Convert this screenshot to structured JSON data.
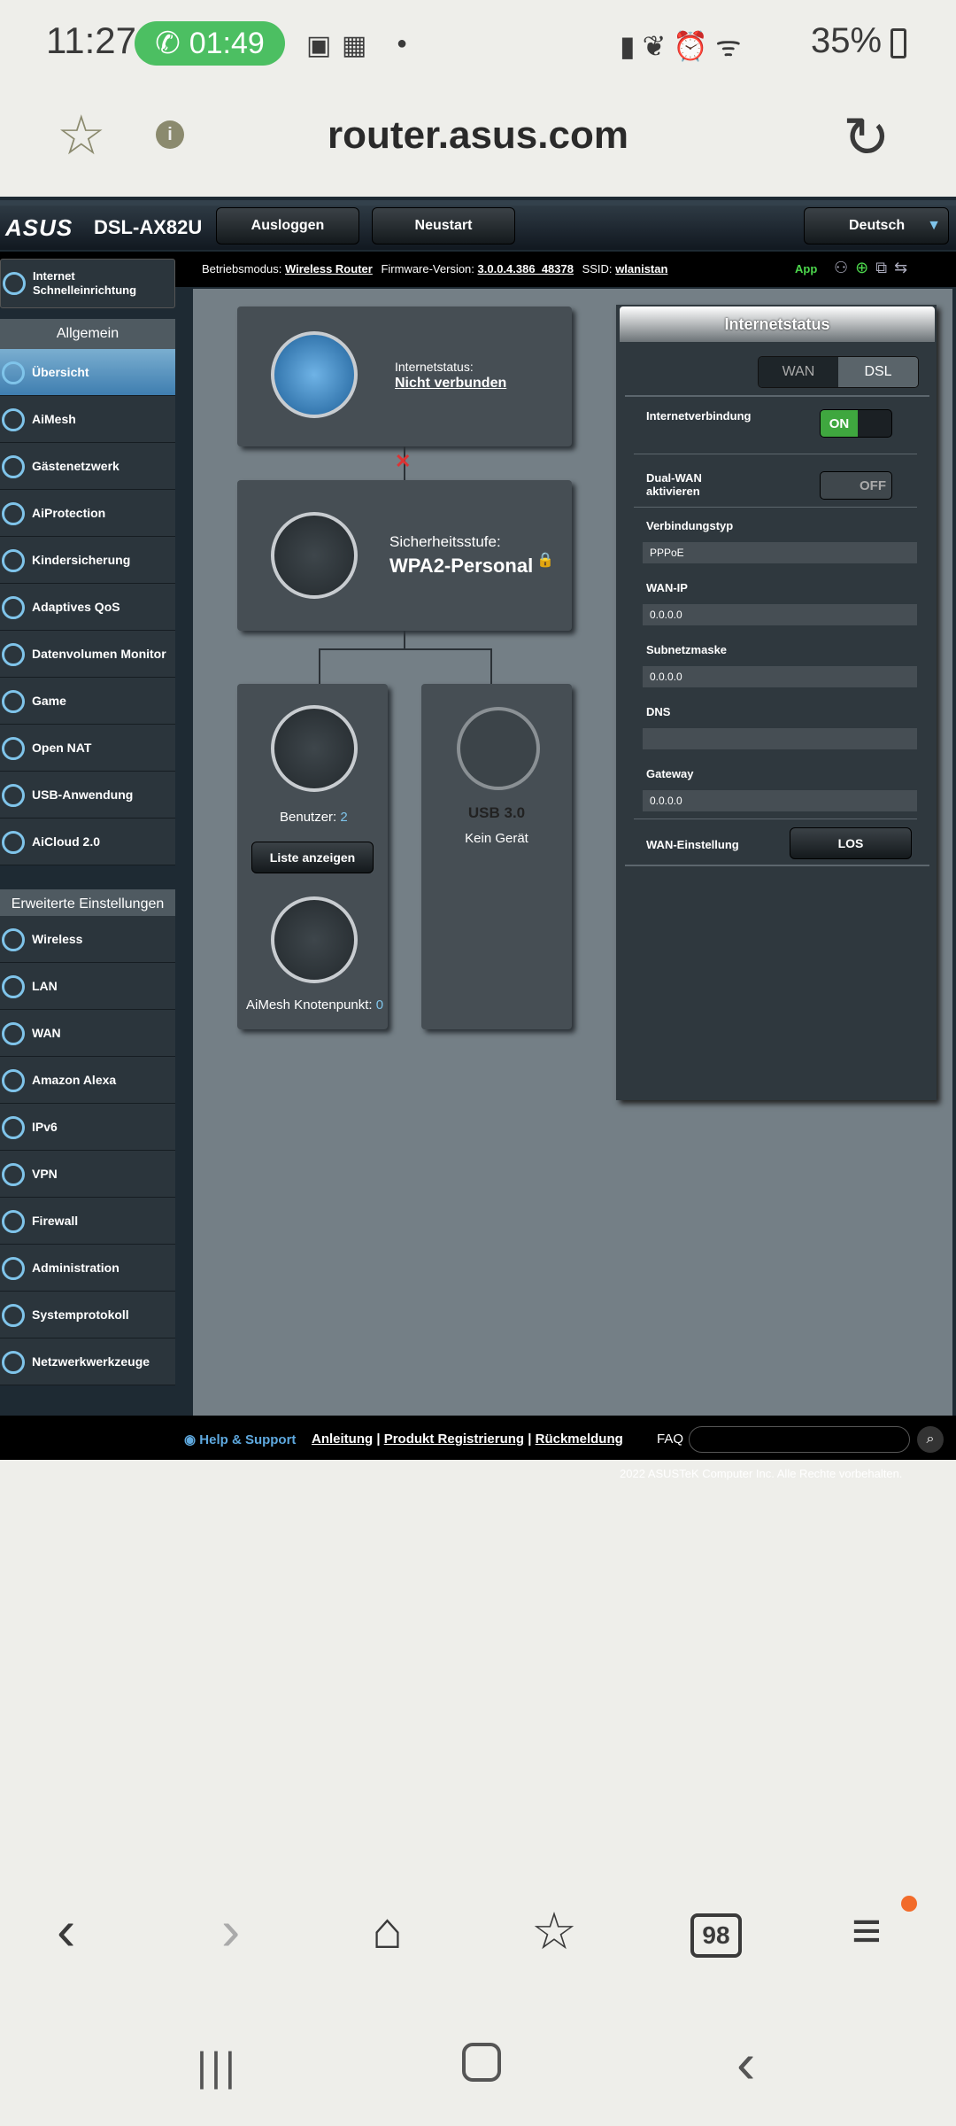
{
  "status_bar": {
    "time": "11:27",
    "call": "01:49",
    "battery": "35%"
  },
  "browser": {
    "url": "router.asus.com"
  },
  "router": {
    "brand": "ASUS",
    "model": "DSL-AX82U",
    "buttons": {
      "logout": "Ausloggen",
      "restart": "Neustart",
      "language": "Deutsch"
    },
    "info": {
      "mode_label": "Betriebsmodus:",
      "mode": "Wireless Router",
      "fw_label": "Firmware-Version:",
      "fw": "3.0.0.4.386_48378",
      "ssid_label": "SSID:",
      "ssid": "wlanistan",
      "app": "App"
    },
    "sidebar": {
      "quick": "Internet Schnelleinrichtung",
      "general_header": "Allgemein",
      "general": [
        "Übersicht",
        "AiMesh",
        "Gästenetzwerk",
        "AiProtection",
        "Kindersicherung",
        "Adaptives QoS",
        "Datenvolumen Monitor",
        "Game",
        "Open NAT",
        "USB-Anwendung",
        "AiCloud 2.0"
      ],
      "advanced_header": "Erweiterte Einstellungen",
      "advanced": [
        "Wireless",
        "LAN",
        "WAN",
        "Amazon Alexa",
        "IPv6",
        "VPN",
        "Firewall",
        "Administration",
        "Systemprotokoll",
        "Netzwerkwerkzeuge"
      ]
    },
    "map": {
      "internet_label": "Internetstatus:",
      "internet_value": "Nicht verbunden",
      "security_label": "Sicherheitsstufe:",
      "security_value": "WPA2-Personal",
      "clients_label": "Benutzer:",
      "clients_count": "2",
      "list_button": "Liste anzeigen",
      "usb_label": "USB 3.0",
      "usb_value": "Kein Gerät",
      "aimesh_label": "AiMesh Knotenpunkt:",
      "aimesh_count": "0"
    },
    "panel": {
      "title": "Internetstatus",
      "tab_wan": "WAN",
      "tab_dsl": "DSL",
      "conn_label": "Internetverbindung",
      "conn_toggle": "ON",
      "dualwan_label_1": "Dual-WAN",
      "dualwan_label_2": "aktivieren",
      "dualwan_toggle": "OFF",
      "type_label": "Verbindungstyp",
      "type_value": "PPPoE",
      "ip_label": "WAN-IP",
      "ip_value": "0.0.0.0",
      "mask_label": "Subnetzmaske",
      "mask_value": "0.0.0.0",
      "dns_label": "DNS",
      "dns_value": "",
      "gw_label": "Gateway",
      "gw_value": "0.0.0.0",
      "wanset_label": "WAN-Einstellung",
      "wanset_button": "LOS"
    },
    "footer": {
      "help": "Help & Support",
      "manual": "Anleitung",
      "register": "Produkt Registrierung",
      "feedback": "Rückmeldung",
      "faq": "FAQ",
      "copyright": "2022 ASUSTeK Computer Inc. Alle Rechte vorbehalten."
    }
  },
  "bottom_nav": {
    "tabs_count": "98"
  }
}
